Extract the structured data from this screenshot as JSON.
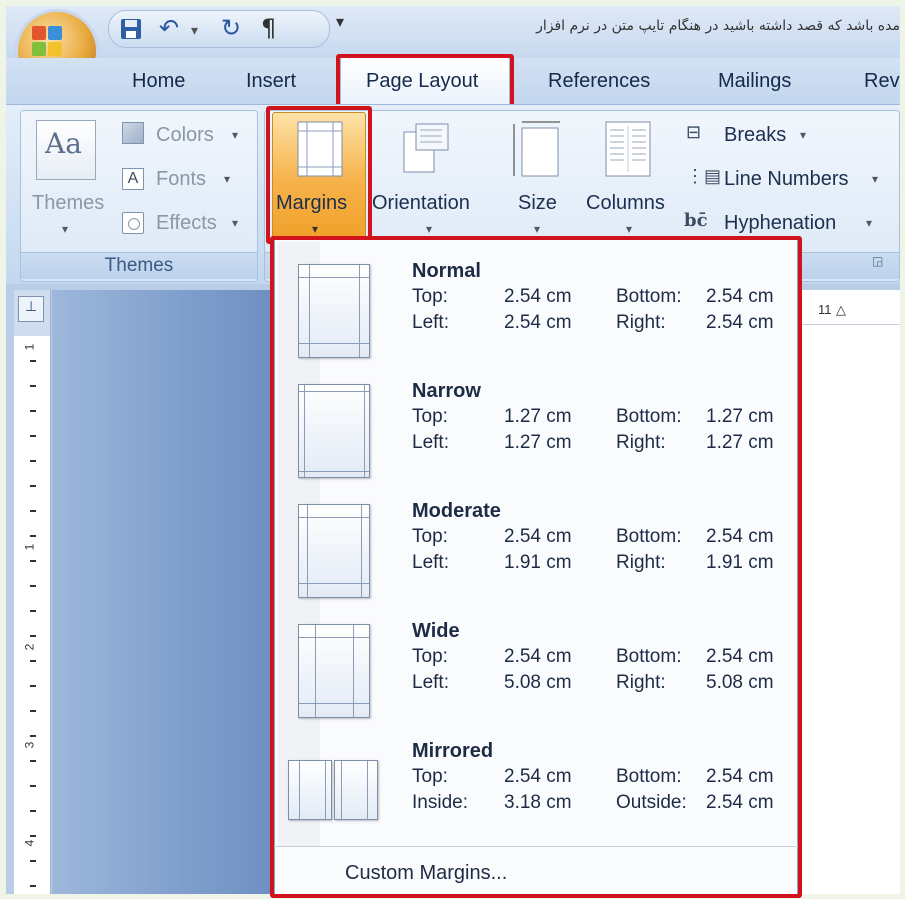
{
  "window": {
    "title": "مده باشد که قصد داشته باشید در هنگام تایپ متن در نرم افزار",
    "quick_access": {
      "save_icon": "save-icon",
      "undo_icon": "undo-icon",
      "dropdown": "▾",
      "redo_icon": "redo-icon",
      "format_icon": "paragraph-icon"
    }
  },
  "tabs": [
    "Home",
    "Insert",
    "Page Layout",
    "References",
    "Mailings",
    "Rev"
  ],
  "active_tab": "Page Layout",
  "ribbon": {
    "themes_group": {
      "themes_label": "Themes",
      "colors_label": "Colors",
      "fonts_label": "Fonts",
      "effects_label": "Effects",
      "group_label": "Themes"
    },
    "page_setup_group": {
      "margins_label": "Margins",
      "orientation_label": "Orientation",
      "size_label": "Size",
      "columns_label": "Columns",
      "breaks_label": "Breaks",
      "line_numbers_label": "Line Numbers",
      "hyphenation_label": "Hyphenation"
    }
  },
  "ruler": {
    "vertical_numbers": [
      "1",
      "1",
      "2",
      "3",
      "4"
    ],
    "horizontal_text": "11"
  },
  "margins_menu": {
    "items": [
      {
        "name": "Normal",
        "row1": {
          "l1": "Top:",
          "v1": "2.54 cm",
          "l2": "Bottom:",
          "v2": "2.54 cm"
        },
        "row2": {
          "l1": "Left:",
          "v1": "2.54 cm",
          "l2": "Right:",
          "v2": "2.54 cm"
        }
      },
      {
        "name": "Narrow",
        "row1": {
          "l1": "Top:",
          "v1": "1.27 cm",
          "l2": "Bottom:",
          "v2": "1.27 cm"
        },
        "row2": {
          "l1": "Left:",
          "v1": "1.27 cm",
          "l2": "Right:",
          "v2": "1.27 cm"
        }
      },
      {
        "name": "Moderate",
        "row1": {
          "l1": "Top:",
          "v1": "2.54 cm",
          "l2": "Bottom:",
          "v2": "2.54 cm"
        },
        "row2": {
          "l1": "Left:",
          "v1": "1.91 cm",
          "l2": "Right:",
          "v2": "1.91 cm"
        }
      },
      {
        "name": "Wide",
        "row1": {
          "l1": "Top:",
          "v1": "2.54 cm",
          "l2": "Bottom:",
          "v2": "2.54 cm"
        },
        "row2": {
          "l1": "Left:",
          "v1": "5.08 cm",
          "l2": "Right:",
          "v2": "5.08 cm"
        }
      },
      {
        "name": "Mirrored",
        "row1": {
          "l1": "Top:",
          "v1": "2.54 cm",
          "l2": "Bottom:",
          "v2": "2.54 cm"
        },
        "row2": {
          "l1": "Inside:",
          "v1": "3.18 cm",
          "l2": "Outside:",
          "v2": "2.54 cm"
        }
      }
    ],
    "custom_label": "Custom Margins..."
  },
  "colors": {
    "highlight_red": "#d0131d",
    "ribbon_blue": "#cddff2",
    "margins_button_orange": "#f6b24a"
  }
}
